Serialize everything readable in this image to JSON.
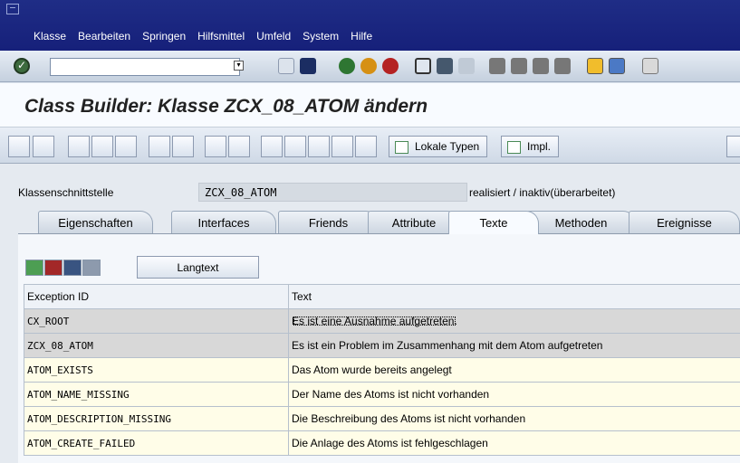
{
  "menu": {
    "items": [
      "Klasse",
      "Bearbeiten",
      "Springen",
      "Hilfsmittel",
      "Umfeld",
      "System",
      "Hilfe"
    ]
  },
  "toolbar": {
    "command_value": ""
  },
  "title": {
    "text": "Class Builder: Klasse ZCX_08_ATOM ändern"
  },
  "app_toolbar": {
    "local_types_label": "Lokale Typen",
    "impl_label": "Impl."
  },
  "header": {
    "label": "Klassenschnittstelle",
    "class_name": "ZCX_08_ATOM",
    "status": "realisiert / inaktiv(überarbeitet)"
  },
  "tabs": [
    "Eigenschaften",
    "Interfaces",
    "Friends",
    "Attribute",
    "Texte",
    "Methoden",
    "Ereignisse"
  ],
  "text_table": {
    "langtext_label": "Langtext",
    "columns": [
      "Exception ID",
      "Text"
    ],
    "rows": [
      {
        "id": "CX_ROOT",
        "text": "Es ist eine Ausnahme aufgetreten."
      },
      {
        "id": "ZCX_08_ATOM",
        "text": "Es ist ein Problem im Zusammenhang mit dem Atom aufgetreten"
      },
      {
        "id": "ATOM_EXISTS",
        "text": "Das Atom wurde bereits angelegt"
      },
      {
        "id": "ATOM_NAME_MISSING",
        "text": "Der Name des Atoms ist nicht vorhanden"
      },
      {
        "id": "ATOM_DESCRIPTION_MISSING",
        "text": "Die Beschreibung des Atoms ist nicht vorhanden"
      },
      {
        "id": "ATOM_CREATE_FAILED",
        "text": "Die Anlage des Atoms ist fehlgeschlagen"
      }
    ]
  },
  "colors": {
    "menu_bar": "#1f2d86",
    "editable_row": "#fffde8",
    "inherited_row": "#d8d8d8"
  }
}
